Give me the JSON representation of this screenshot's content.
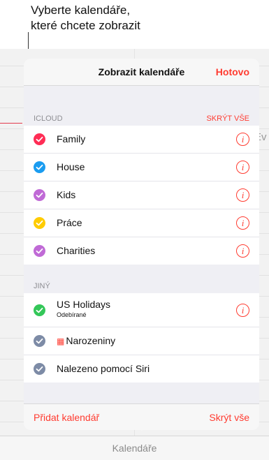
{
  "callout": {
    "line1": "Vyberte kalendáře,",
    "line2": "které chcete zobrazit"
  },
  "background": {
    "ev_text": "Ev",
    "bottom_label": "Kalendáře"
  },
  "panel": {
    "title": "Zobrazit kalendáře",
    "done_label": "Hotovo",
    "icloud": {
      "header": "ICLOUD",
      "hide_all": "SKRÝT VŠE",
      "items": [
        {
          "label": "Family",
          "color": "#ff2d55"
        },
        {
          "label": "House",
          "color": "#1a9cf0"
        },
        {
          "label": "Kids",
          "color": "#c06ad6"
        },
        {
          "label": "Práce",
          "color": "#ffcc00"
        },
        {
          "label": "Charities",
          "color": "#c06ad6"
        }
      ]
    },
    "other": {
      "header": "JINÝ",
      "items": [
        {
          "label": "US Holidays",
          "sublabel": "Odebírané",
          "color": "#34c759"
        },
        {
          "label": "Narozeniny",
          "color": "#7d8ba6",
          "icon": "gift-icon"
        },
        {
          "label": "Nalezeno pomocí Siri",
          "color": "#7d8ba6"
        }
      ]
    },
    "footer": {
      "add_label": "Přidat kalendář",
      "hide_label": "Skrýt vše"
    },
    "accent": "#ff3b30"
  }
}
